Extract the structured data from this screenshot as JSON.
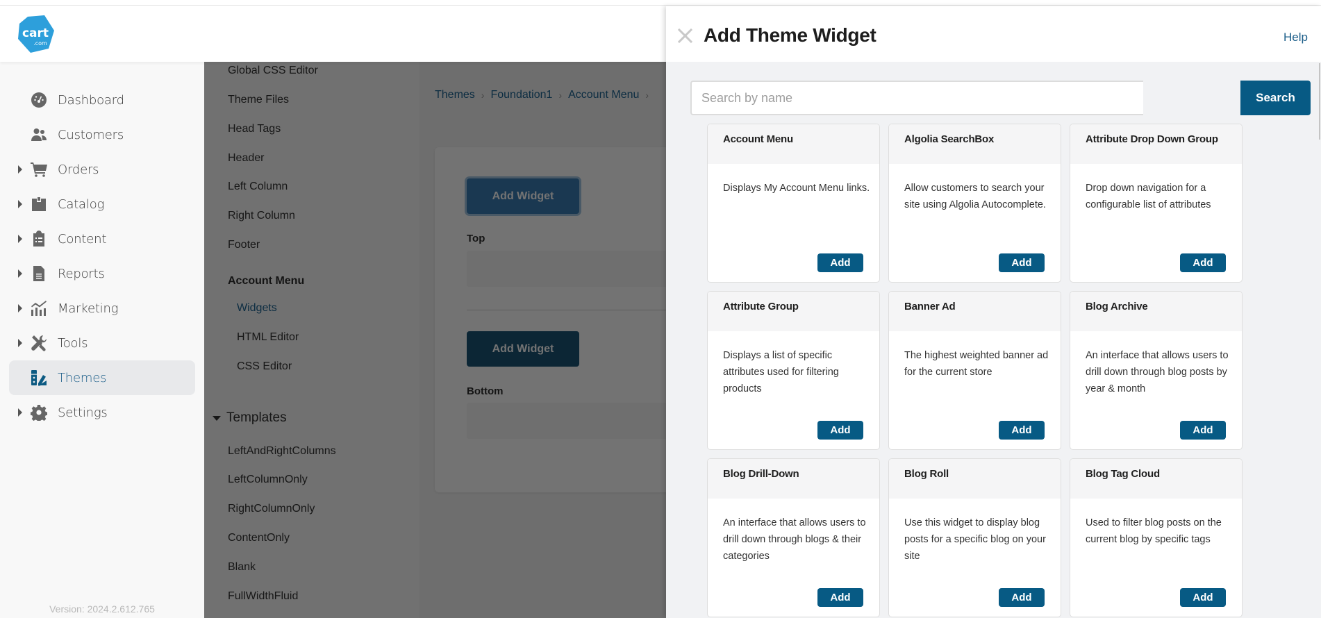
{
  "brand": {
    "logo_text": "cart",
    "logo_subtext": ".com",
    "logo_color": "#2d9fdb"
  },
  "sidebar": {
    "items": [
      {
        "label": "Dashboard",
        "icon": "dashboard-gauge-icon",
        "expandable": false,
        "active": false
      },
      {
        "label": "Customers",
        "icon": "users-icon",
        "expandable": false,
        "active": false
      },
      {
        "label": "Orders",
        "icon": "cart-icon",
        "expandable": true,
        "active": false
      },
      {
        "label": "Catalog",
        "icon": "box-icon",
        "expandable": true,
        "active": false
      },
      {
        "label": "Content",
        "icon": "clipboard-list-icon",
        "expandable": true,
        "active": false
      },
      {
        "label": "Reports",
        "icon": "file-report-icon",
        "expandable": true,
        "active": false
      },
      {
        "label": "Marketing",
        "icon": "chart-bars-icon",
        "expandable": true,
        "active": false
      },
      {
        "label": "Tools",
        "icon": "tools-icon",
        "expandable": true,
        "active": false
      },
      {
        "label": "Themes",
        "icon": "swatchbook-icon",
        "expandable": false,
        "active": true
      },
      {
        "label": "Settings",
        "icon": "gear-icon",
        "expandable": true,
        "active": false
      }
    ],
    "version": "Version: 2024.2.612.765",
    "active_color": "#1d5f8a"
  },
  "sub_menu": {
    "items": [
      {
        "label": "Global CSS Editor"
      },
      {
        "label": "Theme Files"
      },
      {
        "label": "Head Tags"
      },
      {
        "label": "Header"
      },
      {
        "label": "Left Column"
      },
      {
        "label": "Right Column"
      },
      {
        "label": "Footer"
      }
    ],
    "group": {
      "label": "Account Menu",
      "children": [
        {
          "label": "Widgets",
          "active": true
        },
        {
          "label": "HTML Editor",
          "active": false
        },
        {
          "label": "CSS Editor",
          "active": false
        }
      ]
    },
    "templates": {
      "label": "Templates",
      "expanded": true,
      "items": [
        {
          "label": "LeftAndRightColumns"
        },
        {
          "label": "LeftColumnOnly"
        },
        {
          "label": "RightColumnOnly"
        },
        {
          "label": "ContentOnly"
        },
        {
          "label": "Blank"
        },
        {
          "label": "FullWidthFluid"
        }
      ]
    }
  },
  "page": {
    "breadcrumb": [
      "Themes",
      "Foundation1",
      "Account Menu"
    ],
    "breadcrumb_separator": "›",
    "zones": [
      {
        "button_label": "Add Widget",
        "zone_label": "Top"
      },
      {
        "button_label": "Add Widget",
        "zone_label": "Bottom"
      }
    ]
  },
  "drawer": {
    "title": "Add Theme Widget",
    "help_label": "Help",
    "search": {
      "placeholder": "Search by name",
      "value": "",
      "button_label": "Search"
    },
    "accent_color": "#075a84",
    "widgets": [
      {
        "title": "Account Menu",
        "description": "Displays My Account Menu links.",
        "button_label": "Add"
      },
      {
        "title": "Algolia SearchBox",
        "description": "Allow customers to search your site using Algolia Autocomplete.",
        "button_label": "Add"
      },
      {
        "title": "Attribute Drop Down Group",
        "description": "Drop down navigation for a configurable list of attributes",
        "button_label": "Add"
      },
      {
        "title": "Attribute Group",
        "description": "Displays a list of specific attributes used for filtering products",
        "button_label": "Add"
      },
      {
        "title": "Banner Ad",
        "description": "The highest weighted banner ad for the current store",
        "button_label": "Add"
      },
      {
        "title": "Blog Archive",
        "description": "An interface that allows users to drill down through blog posts by year & month",
        "button_label": "Add"
      },
      {
        "title": "Blog Drill-Down",
        "description": "An interface that allows users to drill down through blogs & their categories",
        "button_label": "Add"
      },
      {
        "title": "Blog Roll",
        "description": "Use this widget to display blog posts for a specific blog on your site",
        "button_label": "Add"
      },
      {
        "title": "Blog Tag Cloud",
        "description": "Used to filter blog posts on the current blog by specific tags",
        "button_label": "Add"
      }
    ]
  }
}
